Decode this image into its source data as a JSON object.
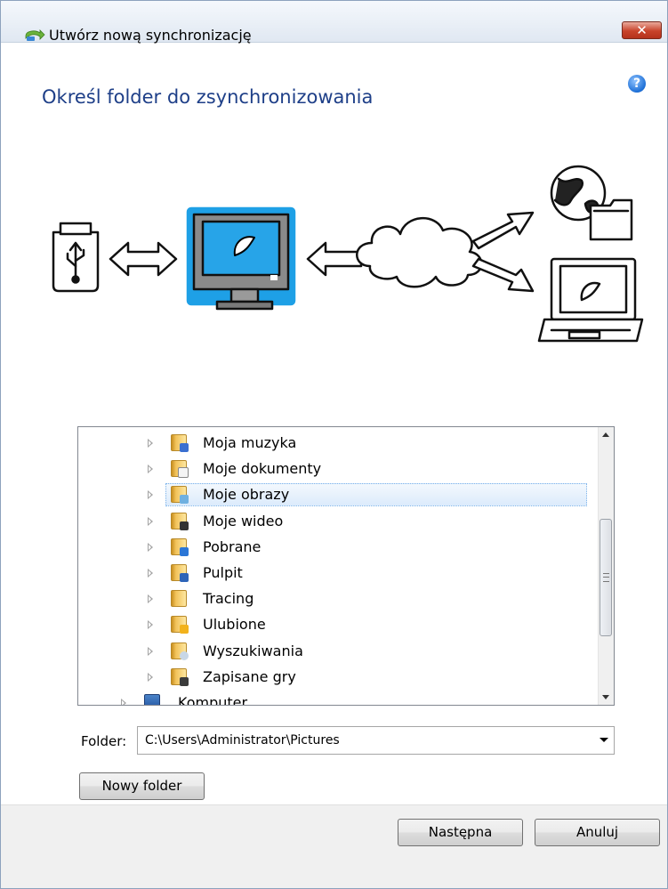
{
  "window": {
    "title": "Utwórz nową synchronizację",
    "close_glyph": "✕",
    "help_glyph": "?"
  },
  "heading": "Określ folder do zsynchronizowania",
  "illustration": {
    "icons": [
      "usb-drive-icon",
      "computer-icon",
      "cloud-icon",
      "globe-icon",
      "folder-icon",
      "laptop-icon"
    ]
  },
  "tree": {
    "items": [
      {
        "label": "Moja muzyka",
        "icon": "music-folder-icon",
        "selected": false
      },
      {
        "label": "Moje dokumenty",
        "icon": "documents-folder-icon",
        "selected": false
      },
      {
        "label": "Moje obrazy",
        "icon": "pictures-folder-icon",
        "selected": true
      },
      {
        "label": "Moje wideo",
        "icon": "video-folder-icon",
        "selected": false
      },
      {
        "label": "Pobrane",
        "icon": "downloads-folder-icon",
        "selected": false
      },
      {
        "label": "Pulpit",
        "icon": "desktop-folder-icon",
        "selected": false
      },
      {
        "label": "Tracing",
        "icon": "folder-icon",
        "selected": false
      },
      {
        "label": "Ulubione",
        "icon": "favorites-folder-icon",
        "selected": false
      },
      {
        "label": "Wyszukiwania",
        "icon": "searches-folder-icon",
        "selected": false
      },
      {
        "label": "Zapisane gry",
        "icon": "saved-games-folder-icon",
        "selected": false
      }
    ],
    "computer_item": "Komputer"
  },
  "folder": {
    "label": "Folder:",
    "value": "C:\\Users\\Administrator\\Pictures"
  },
  "buttons": {
    "new_folder": "Nowy folder",
    "next": "Następna",
    "cancel": "Anuluj"
  }
}
